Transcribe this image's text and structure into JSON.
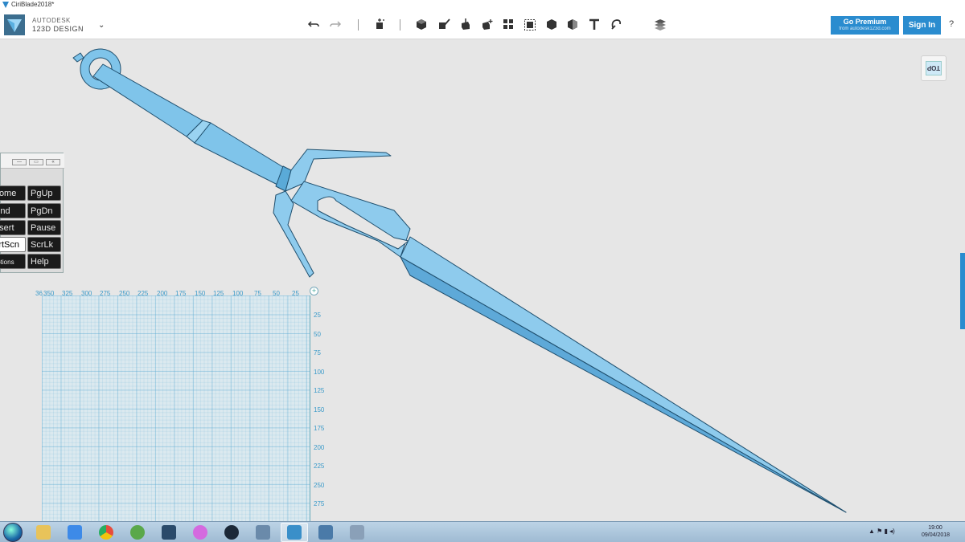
{
  "window": {
    "title": "CiriBlade2018*"
  },
  "app": {
    "brand_line1": "AUTODESK",
    "brand_line2": "123D DESIGN",
    "brand_color": "#3c6e8f",
    "chevron": "⌄"
  },
  "toolbar": {
    "undo_icon": "undo-icon",
    "redo_icon": "redo-icon",
    "tools": [
      "transform-icon",
      "primitives-icon",
      "sketch-icon",
      "construct-icon",
      "modify-icon",
      "pattern-icon",
      "grouping-icon",
      "combine-icon",
      "measure-icon",
      "text-icon",
      "snap-icon",
      "material-icon"
    ],
    "premium_label": "Go Premium",
    "premium_sub": "from autodesk123d.com",
    "signin_label": "Sign In",
    "help_label": "?",
    "accent": "#2a8ccf"
  },
  "viewcube": {
    "face_label": "TOP"
  },
  "model": {
    "color": "#7fc4ea",
    "edge_color": "#1f4f6e"
  },
  "osk": {
    "window_buttons": [
      "—",
      "▭",
      "«"
    ],
    "keys": [
      [
        "Home",
        "PgUp"
      ],
      [
        "End",
        "PgDn"
      ],
      [
        "Insert",
        "Pause"
      ],
      [
        "PrtScn",
        "ScrLk"
      ],
      [
        "Options",
        "Help"
      ]
    ]
  },
  "ruler": {
    "x_ticks": [
      "350",
      "325",
      "300",
      "275",
      "250",
      "225",
      "200",
      "175",
      "150",
      "125",
      "100",
      "75",
      "50",
      "25"
    ],
    "x_partial": "36",
    "y_ticks": [
      "25",
      "50",
      "75",
      "100",
      "125",
      "150",
      "175",
      "200",
      "225",
      "250",
      "275"
    ],
    "plus": "+"
  },
  "taskbar": {
    "apps": [
      {
        "name": "explorer-icon",
        "color": "#e8c35a"
      },
      {
        "name": "dropbox-icon",
        "color": "#3d8ae8"
      },
      {
        "name": "chrome-icon",
        "color": "#e74c3c"
      },
      {
        "name": "minecraft-icon",
        "color": "#5aa84a"
      },
      {
        "name": "app-icon",
        "color": "#2a4a6a"
      },
      {
        "name": "itunes-icon",
        "color": "#d46adf"
      },
      {
        "name": "steam-icon",
        "color": "#1b2838"
      },
      {
        "name": "printer-icon",
        "color": "#6a8aaa"
      },
      {
        "name": "123d-icon",
        "color": "#3a8fc9"
      },
      {
        "name": "photo-viewer-icon",
        "color": "#4a7aa8"
      },
      {
        "name": "calculator-icon",
        "color": "#8aa0b8"
      }
    ],
    "tray_text": "▲ ⚑ ▮ ◂)",
    "clock_time": "19:00",
    "clock_date": "09/04/2018"
  }
}
